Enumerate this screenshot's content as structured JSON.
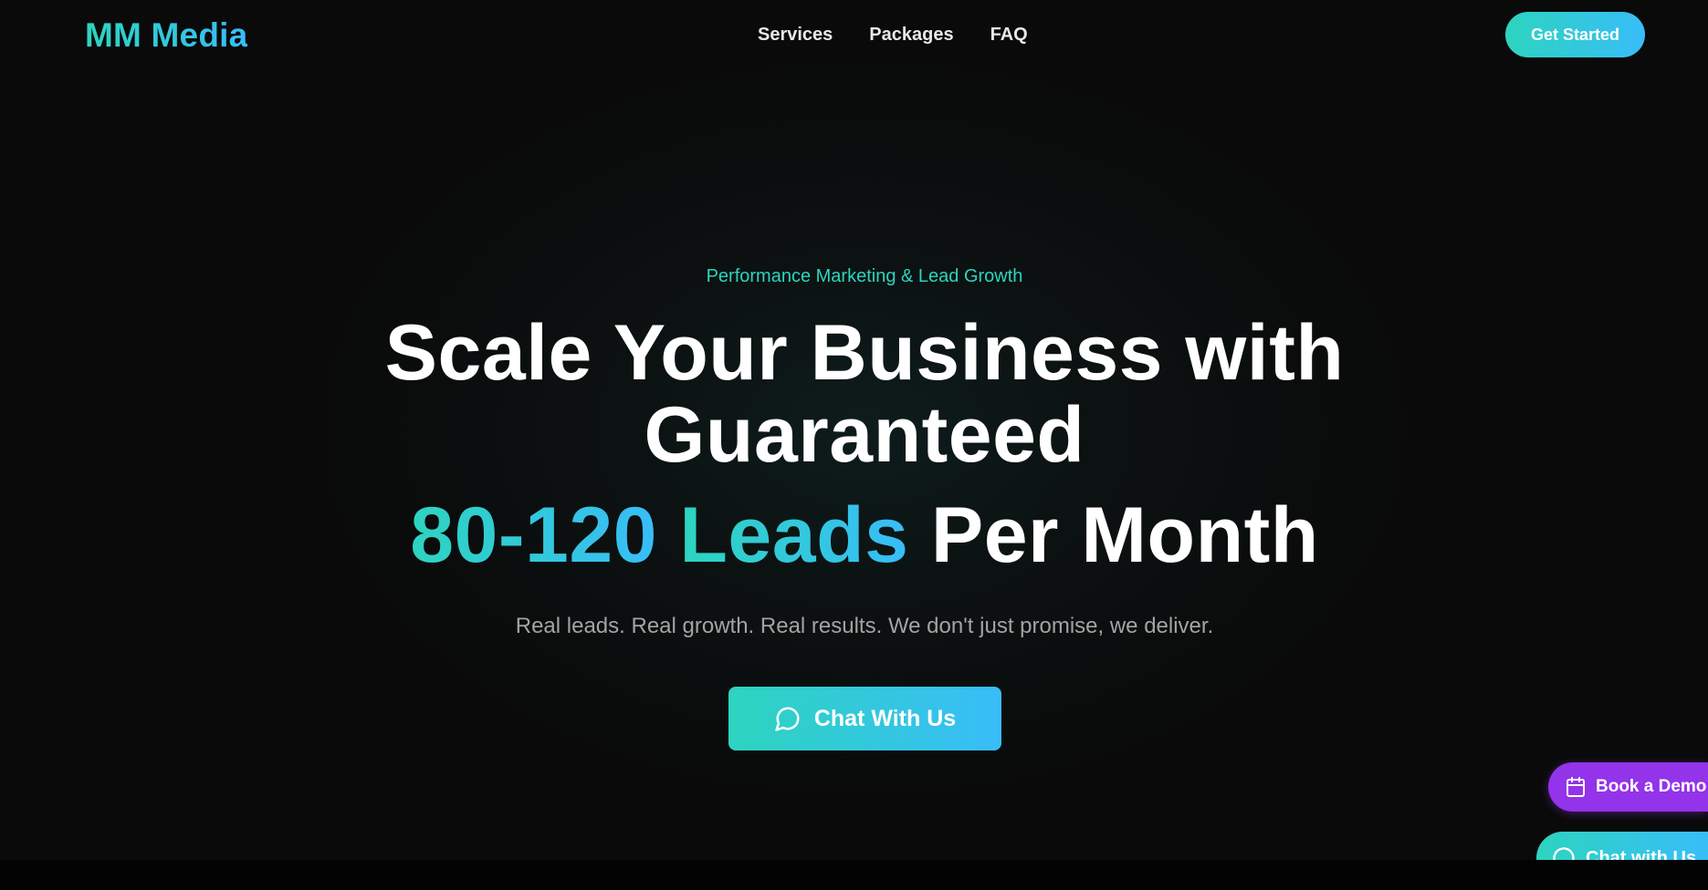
{
  "header": {
    "logo": "MM Media",
    "nav": [
      {
        "label": "Services"
      },
      {
        "label": "Packages"
      },
      {
        "label": "FAQ"
      }
    ],
    "cta_label": "Get Started"
  },
  "hero": {
    "eyebrow": "Performance Marketing & Lead Growth",
    "headline_line1": "Scale Your Business with",
    "headline_line2": "Guaranteed",
    "headline_highlight_numbers": "80-120",
    "headline_highlight_word": "Leads",
    "headline_tail": "Per Month",
    "subheadline": "Real leads. Real growth. Real results. We don't just promise, we deliver.",
    "cta_label": "Chat With Us",
    "cta_icon": "chat-bubble-icon"
  },
  "floating": {
    "book_demo_label": "Book a Demo",
    "book_demo_icon": "calendar-icon",
    "chat_label": "Chat with Us",
    "chat_icon": "chat-bubble-icon"
  },
  "colors": {
    "accent_teal": "#2dd4bf",
    "accent_sky": "#38bdf8",
    "demo_purple": "#9333ea",
    "background": "#0b0b0b"
  }
}
